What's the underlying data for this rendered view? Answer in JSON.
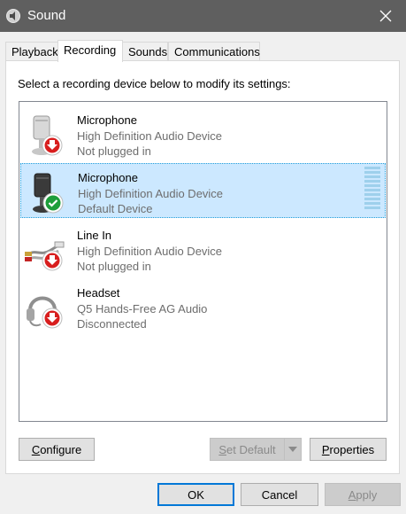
{
  "window": {
    "title": "Sound",
    "app_icon": "speaker-icon",
    "close_icon": "close-icon"
  },
  "tabs": [
    {
      "label": "Playback",
      "active": false
    },
    {
      "label": "Recording",
      "active": true
    },
    {
      "label": "Sounds",
      "active": false
    },
    {
      "label": "Communications",
      "active": false
    }
  ],
  "instruction": "Select a recording device below to modify its settings:",
  "devices": [
    {
      "name": "Microphone",
      "description": "High Definition Audio Device",
      "status": "Not plugged in",
      "icon": "microphone-icon",
      "badge": "red-down-arrow-badge",
      "selected": false
    },
    {
      "name": "Microphone",
      "description": "High Definition Audio Device",
      "status": "Default Device",
      "icon": "microphone-icon",
      "badge": "green-check-badge",
      "selected": true
    },
    {
      "name": "Line In",
      "description": "High Definition Audio Device",
      "status": "Not plugged in",
      "icon": "line-in-cable-icon",
      "badge": "red-down-arrow-badge",
      "selected": false
    },
    {
      "name": "Headset",
      "description": "Q5 Hands-Free AG Audio",
      "status": "Disconnected",
      "icon": "headset-icon",
      "badge": "red-down-arrow-badge",
      "selected": false
    }
  ],
  "buttons": {
    "configure": {
      "prefix": "",
      "accel": "C",
      "rest": "onfigure"
    },
    "set_default": {
      "prefix": "",
      "accel": "S",
      "rest": "et Default",
      "enabled": false
    },
    "properties": {
      "prefix": "",
      "accel": "P",
      "rest": "roperties"
    },
    "ok": "OK",
    "cancel": "Cancel",
    "apply": {
      "prefix": "",
      "accel": "A",
      "rest": "pply",
      "enabled": false
    }
  },
  "colors": {
    "titlebar": "#5f5f5f",
    "selection": "#cce8ff",
    "accent": "#0078d7",
    "success": "#1e9e3a",
    "warning": "#d81e1e"
  }
}
